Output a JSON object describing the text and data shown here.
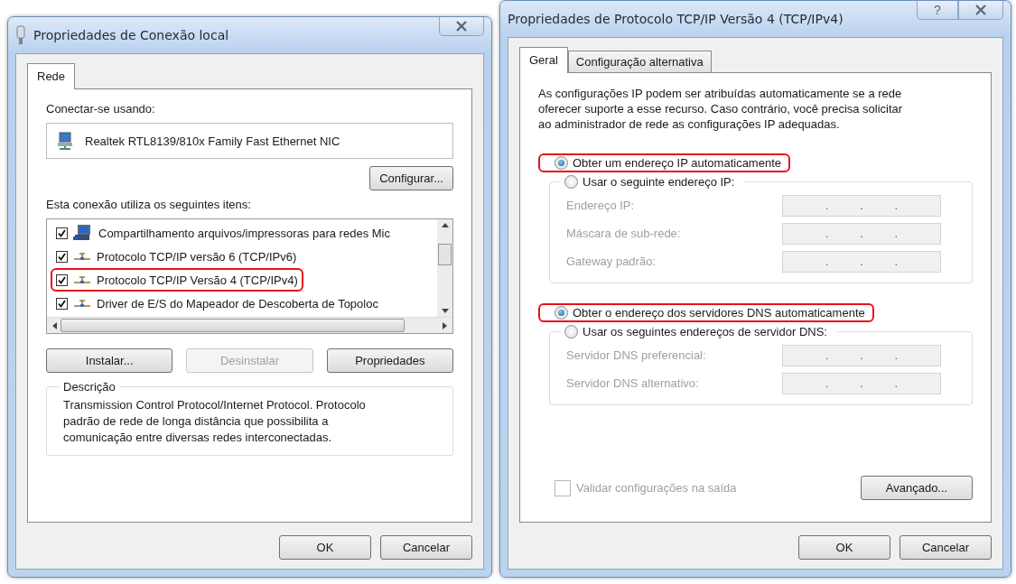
{
  "left_window": {
    "title": "Propriedades de Conexão local",
    "tabs": [
      {
        "label": "Rede",
        "selected": true
      }
    ],
    "connect_label": "Conectar-se usando:",
    "adapter": "Realtek RTL8139/810x Family Fast Ethernet NIC",
    "configure_button": "Configurar...",
    "items_label": "Esta conexão utiliza os seguintes itens:",
    "items": [
      {
        "kind": "computer",
        "checked": true,
        "label": "Compartilhamento arquivos/impressoras para redes Mic",
        "highlighted": false
      },
      {
        "kind": "protocol",
        "checked": true,
        "label": "Protocolo TCP/IP versão 6 (TCP/IPv6)",
        "highlighted": false
      },
      {
        "kind": "protocol",
        "checked": true,
        "label": "Protocolo TCP/IP Versão 4 (TCP/IPv4)",
        "highlighted": true
      },
      {
        "kind": "protocol",
        "checked": true,
        "label": "Driver de E/S do Mapeador de Descoberta de Topoloc",
        "highlighted": false
      }
    ],
    "buttons": [
      {
        "label": "Instalar...",
        "disabled": false
      },
      {
        "label": "Desinstalar",
        "disabled": true
      },
      {
        "label": "Propriedades",
        "disabled": false
      }
    ],
    "description": {
      "legend": "Descrição",
      "text": "Transmission Control Protocol/Internet Protocol. Protocolo padrão de rede de longa distância que possibilita a comunicação entre diversas redes interconectadas."
    },
    "footer_buttons": [
      "OK",
      "Cancelar"
    ]
  },
  "right_window": {
    "title": "Propriedades de Protocolo TCP/IP Versão 4 (TCP/IPv4)",
    "help": "?",
    "tabs": [
      {
        "label": "Geral",
        "selected": true
      },
      {
        "label": "Configuração alternativa",
        "selected": false
      }
    ],
    "intro": "As configurações IP podem ser atribuídas automaticamente se a rede oferecer suporte a esse recurso. Caso contrário, você precisa solicitar ao administrador de rede as configurações IP adequadas.",
    "ip_options": [
      {
        "label": "Obter um endereço IP automaticamente",
        "selected": true,
        "highlighted": true
      },
      {
        "label": "Usar o seguinte endereço IP:",
        "selected": false,
        "highlighted": false
      }
    ],
    "ip_fields": [
      {
        "label": "Endereço IP:",
        "disabled": true,
        "dots": [
          ".",
          ".",
          "."
        ]
      },
      {
        "label": "Máscara de sub-rede:",
        "disabled": true,
        "dots": [
          ".",
          ".",
          "."
        ]
      },
      {
        "label": "Gateway padrão:",
        "disabled": true,
        "dots": [
          ".",
          ".",
          "."
        ]
      }
    ],
    "dns_options": [
      {
        "label": "Obter o endereço dos servidores DNS automaticamente",
        "selected": true,
        "highlighted": true
      },
      {
        "label": "Usar os seguintes endereços de servidor DNS:",
        "selected": false,
        "highlighted": false
      }
    ],
    "dns_fields": [
      {
        "label": "Servidor DNS preferencial:",
        "disabled": true,
        "dots": [
          ".",
          ".",
          "."
        ]
      },
      {
        "label": "Servidor DNS alternativo:",
        "disabled": true,
        "dots": [
          ".",
          ".",
          "."
        ]
      }
    ],
    "validate": {
      "label": "Validar configurações na saída",
      "checked": false,
      "disabled": true
    },
    "advanced_button": "Avançado...",
    "footer_buttons": [
      "OK",
      "Cancelar"
    ]
  }
}
